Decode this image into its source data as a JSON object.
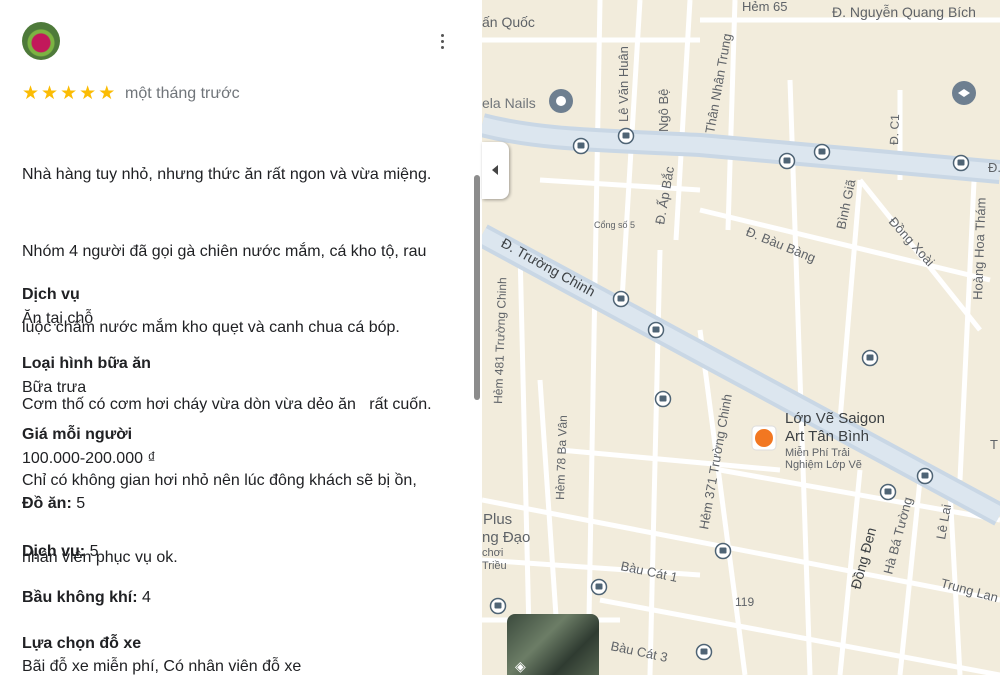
{
  "review": {
    "rating_stars": 5,
    "date": "một tháng trước",
    "text_lines": [
      "Nhà hàng tuy nhỏ, nhưng thức ăn rất ngon và vừa miệng.",
      "Nhóm 4 người đã gọi gà chiên nước mắm, cá kho tộ, rau",
      "luộc chấm nước mắm kho quẹt và canh chua cá bóp.",
      "Cơm thố có cơm hơi cháy vừa dòn vừa dẻo ăn   rất cuốn.",
      "Chỉ có không gian hơi nhỏ nên lúc đông khách sẽ bị ồn,",
      "nhân viên phục vụ ok."
    ]
  },
  "attributes": {
    "service": {
      "label": "Dịch vụ",
      "value": "Ăn tại chỗ"
    },
    "meal_type": {
      "label": "Loại hình bữa ăn",
      "value": "Bữa trưa"
    },
    "price": {
      "label": "Giá mỗi người",
      "value": "100.000-200.000 ₫"
    },
    "food": {
      "label": "Đồ ăn:",
      "value": " 5"
    },
    "service_score": {
      "label": "Dịch vụ:",
      "value": " 5"
    },
    "atmosphere": {
      "label": "Bầu không khí:",
      "value": " 4"
    },
    "parking": {
      "label": "Lựa chọn đỗ xe",
      "value": "Bãi đỗ xe miễn phí, Có nhân viên đỗ xe"
    }
  },
  "map": {
    "labels": {
      "hem65": "Hẻm 65",
      "nguyen_quang_bich": "Đ. Nguyễn Quang Bích",
      "an_quoc": "ấn Quốc",
      "le_van_huan": "Lê Văn Huân",
      "ngo_be": "Ngô Bệ",
      "than_nhan_trung": "Thân Nhân Trung",
      "dc1": "Đ. C1",
      "ela_nails": "ela Nails",
      "d_right": "Đ.",
      "ap_bac": "Đ. Ấp Bắc",
      "cong_so5": "Cổng số 5",
      "bau_bang": "Đ. Bàu Bàng",
      "binh_gia": "Bình Giã",
      "dong_xoai": "Đồng Xoài",
      "hoang_hoa_tham": "Hoàng Hoa Thám",
      "truong_chinh": "Đ. Trường Chinh",
      "hem481": "Hẻm 481 Trường Chinh",
      "hem78": "Hẻm 78 Ba Vân",
      "poi_name_1": "Lớp Vẽ Saigon",
      "poi_name_2": "Art Tân Bình",
      "poi_sub_1": "Miễn Phí Trải",
      "poi_sub_2": "Nghiệm Lớp Vẽ",
      "hem371": "Hẻm 371 Trường Chinh",
      "dong_den": "Đồng Đen",
      "ha_ba_tuong": "Hà Bá Tường",
      "le_lai": "Lê Lai",
      "plus": "Plus",
      "ng_dao": "ng Đạo",
      "choi": "chơi",
      "trieu": "Triều",
      "bau_cat1": "Bàu Cát 1",
      "n119": "119",
      "trung_lang": "Trung Lan",
      "bau_cat3": "Bàu Cát 3",
      "t_right": "T"
    }
  },
  "colors": {
    "star": "#fbbc04",
    "map_bg": "#f2ecdc",
    "major_road": "#c7d7e6",
    "poi_orange": "#f27721"
  },
  "icons": [
    "more-vert-icon",
    "star-icon",
    "bus-stop-icon",
    "collapse-arrow-icon",
    "layers-icon",
    "nail-salon-pin-icon",
    "school-pin-icon"
  ]
}
